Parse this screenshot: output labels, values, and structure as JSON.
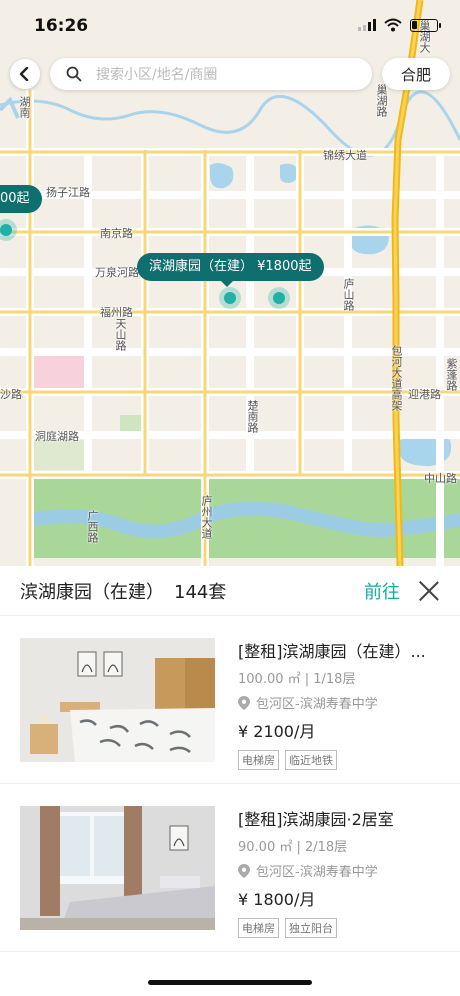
{
  "status_bar": {
    "time": "16:26"
  },
  "search": {
    "placeholder": "搜索小区/地名/商圈",
    "city": "合肥"
  },
  "map": {
    "bubbles": [
      {
        "label": "滨湖康园（在建）  ¥1800起"
      },
      {
        "label": "00起"
      }
    ],
    "labels": {
      "jinxiu": "锦绣大道",
      "yangzijiang": "扬子江路",
      "nanjing": "南京路",
      "wanquanhe": "万泉河路",
      "fuzhou": "福州路",
      "tianshan": "天山路",
      "dongtinghu": "洞庭湖路",
      "chunan": "楚南路",
      "lushan": "庐山路",
      "baohe": "包河大道高架",
      "yingang": "迎港路",
      "zhongshan": "中山路",
      "guangxi": "广西路",
      "luzhou": "庐州大道",
      "chaohu": "巢湖大",
      "shaolu": "沙路",
      "ziyun": "紫蓬路",
      "hunan": "湖南",
      "jishan": "巢湖路"
    }
  },
  "panel": {
    "title": "滨湖康园（在建）",
    "count": "144套",
    "go": "前往"
  },
  "listings": [
    {
      "title": "[整租]滨湖康园（在建）...",
      "meta": "100.00 ㎡ | 1/18层",
      "location": "包河区-滨湖寿春中学",
      "price": "¥ 2100/月",
      "tags": [
        "电梯房",
        "临近地铁"
      ]
    },
    {
      "title": "[整租]滨湖康园·2居室",
      "meta": "90.00 ㎡ | 2/18层",
      "location": "包河区-滨湖寿春中学",
      "price": "¥ 1800/月",
      "tags": [
        "电梯房",
        "独立阳台"
      ]
    }
  ],
  "colors": {
    "accent": "#19a99e",
    "bubble": "#0f6f6f",
    "road_main": "#f5c518"
  }
}
